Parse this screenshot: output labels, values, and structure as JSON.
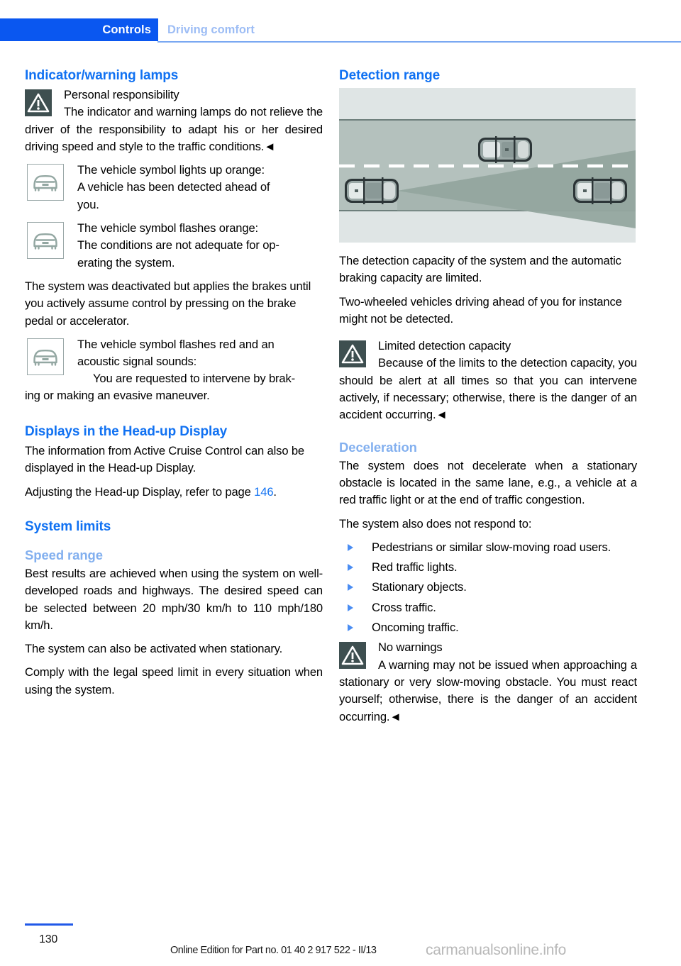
{
  "header": {
    "chapter": "Controls",
    "section": "Driving comfort"
  },
  "left_column": {
    "heading_indicator": "Indicator/warning lamps",
    "warning_personal": {
      "title": "Personal responsibility",
      "body": "The indicator and warning lamps do not relieve the driver of the responsibility to adapt his or her desired driving speed and style to the traffic conditions.◄",
      "icon": "warning-triangle-icon"
    },
    "symbol_orange_steady": {
      "icon": "vehicle-front-symbol-icon",
      "line1": "The vehicle symbol lights up orange:",
      "line2": "A vehicle has been detected ahead of",
      "line3": "you."
    },
    "symbol_orange_flashing": {
      "icon": "vehicle-front-symbol-icon",
      "line1": "The vehicle symbol flashes orange:",
      "line2": "The conditions are not adequate for op-",
      "line3": "erating the system."
    },
    "paragraph_deactivated": "The system was deactivated but applies the brakes until you actively assume control by pressing on the brake pedal or accelerator.",
    "symbol_red_flashing": {
      "icon": "vehicle-front-symbol-icon",
      "line1": "The vehicle symbol flashes red and an",
      "line2": "acoustic signal sounds:",
      "line3": "You are requested to intervene by brak-"
    },
    "paragraph_intervene_cont": "ing or making an evasive maneuver.",
    "heading_hud": "Displays in the Head-up Display",
    "paragraph_hud_1": "The information from Active Cruise Control can also be displayed in the Head-up Display.",
    "paragraph_hud_2_pre": "Adjusting the Head-up Display, refer to page ",
    "paragraph_hud_2_page": "146",
    "paragraph_hud_2_post": ".",
    "heading_system_limits": "System limits",
    "heading_speed_range": "Speed range",
    "paragraph_speed_1": "Best results are achieved when using the system on well-developed roads and highways. The desired speed can be selected between 20 mph/30 km/h to 110 mph/180 km/h.",
    "paragraph_speed_2": "The system can also be activated when stationary.",
    "paragraph_speed_3": "Comply with the legal speed limit in every situation when using the system."
  },
  "right_column": {
    "heading_detection_range": "Detection range",
    "figure": {
      "name": "detection-range-diagram",
      "alt": "Top-down view of a highway with the host vehicle on the left, a radar detection cone extending forward, a vehicle ahead in the adjacent lane and a vehicle ahead in the same lane",
      "colors": {
        "background": "#dfe5e5",
        "road": "#b4c1bd",
        "cone": "#94a69f",
        "lane_marking": "#ffffff",
        "road_edge": "#6e7f7c"
      }
    },
    "paragraph_capacity": "The detection capacity of the system and the automatic braking capacity are limited.",
    "paragraph_twowheeled": "Two-wheeled vehicles driving ahead of you for instance might not be detected.",
    "warning_limited": {
      "icon": "warning-triangle-icon",
      "title": "Limited detection capacity",
      "body": "Because of the limits to the detection capacity, you should be alert at all times so that you can intervene actively, if necessary; otherwise, there is the danger of an accident occurring.◄"
    },
    "heading_deceleration": "Deceleration",
    "paragraph_decel_1": "The system does not decelerate when a stationary obstacle is located in the same lane, e.g., a vehicle at a red traffic light or at the end of traffic congestion.",
    "paragraph_decel_2": "The system also does not respond to:",
    "bullets": [
      "Pedestrians or similar slow-moving road users.",
      "Red traffic lights.",
      "Stationary objects.",
      "Cross traffic.",
      "Oncoming traffic."
    ],
    "warning_no_warnings": {
      "icon": "warning-triangle-icon",
      "title": "No warnings",
      "body": "A warning may not be issued when approaching a stationary or very slow-moving obstacle. You must react yourself; otherwise, there is the danger of an accident occurring.◄"
    }
  },
  "footer": {
    "page_number": "130",
    "edition": "Online Edition for Part no. 01 40 2 917 522 - II/13",
    "watermark": "carmanualsonline.info"
  },
  "colors": {
    "chapter_tab_bg": "#0a57f0",
    "section_tab_text": "#9dbdf5",
    "major_heading": "#1071f2",
    "minor_heading": "#83b0ef",
    "bullet": "#4a8df3",
    "warning_icon_bg": "#3e4f50",
    "footer_rule": "#2159e8"
  }
}
